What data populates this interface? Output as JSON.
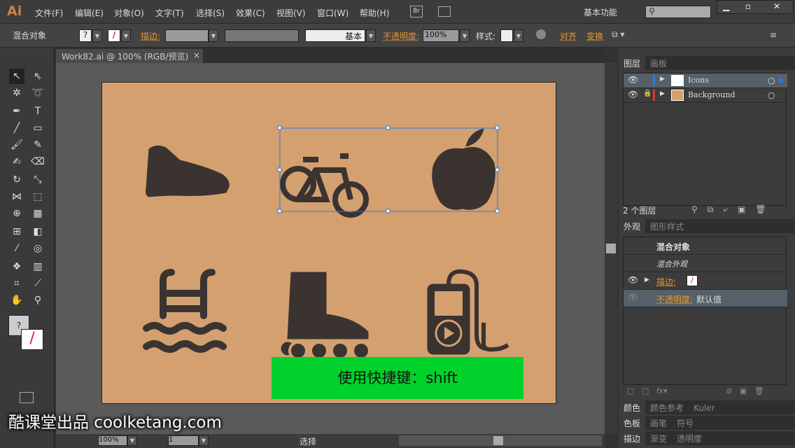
{
  "app": {
    "logo": "Ai",
    "menu": [
      "文件(F)",
      "编辑(E)",
      "对象(O)",
      "文字(T)",
      "选择(S)",
      "效果(C)",
      "视图(V)",
      "窗口(W)",
      "帮助(H)"
    ],
    "bridge": "Br",
    "workspace": "基本功能",
    "search_placeholder": ""
  },
  "control": {
    "object_type": "混合对象",
    "stroke_label": "描边:",
    "stroke_style": "基本",
    "opacity_label": "不透明度:",
    "opacity_value": "100%",
    "style_label": "样式:",
    "align_label": "对齐",
    "transform_label": "变换"
  },
  "document": {
    "tab_title": "Work82.ai @ 100% (RGB/预览)"
  },
  "canvas": {
    "caption": "使用快捷键：shift",
    "artboard_color": "#d4a070",
    "icons": [
      "shoe-icon",
      "bicycle-icon",
      "apple-icon",
      "pool-ladder-icon",
      "inline-skate-icon",
      "music-player-icon"
    ]
  },
  "watermark": "酷课堂出品 coolketang.com",
  "status": {
    "zoom": "100%",
    "artboard": "1",
    "tool": "选择"
  },
  "layers_panel": {
    "tabs": [
      "图层",
      "画板"
    ],
    "layers": [
      {
        "name": "Icons",
        "color": "#2b7ad8"
      },
      {
        "name": "Background",
        "color": "#d83a3a"
      }
    ],
    "count": "2 个图层"
  },
  "appearance_panel": {
    "tabs": [
      "外观",
      "图形样式"
    ],
    "title": "混合对象",
    "subtitle": "混合外观",
    "stroke_label": "描边:",
    "opacity_label": "不透明度:",
    "opacity_value": "默认值"
  },
  "panel_groups": [
    [
      "颜色",
      "颜色参考",
      "Kuler"
    ],
    [
      "色板",
      "画笔",
      "符号"
    ],
    [
      "描边",
      "渐变",
      "透明度"
    ]
  ]
}
